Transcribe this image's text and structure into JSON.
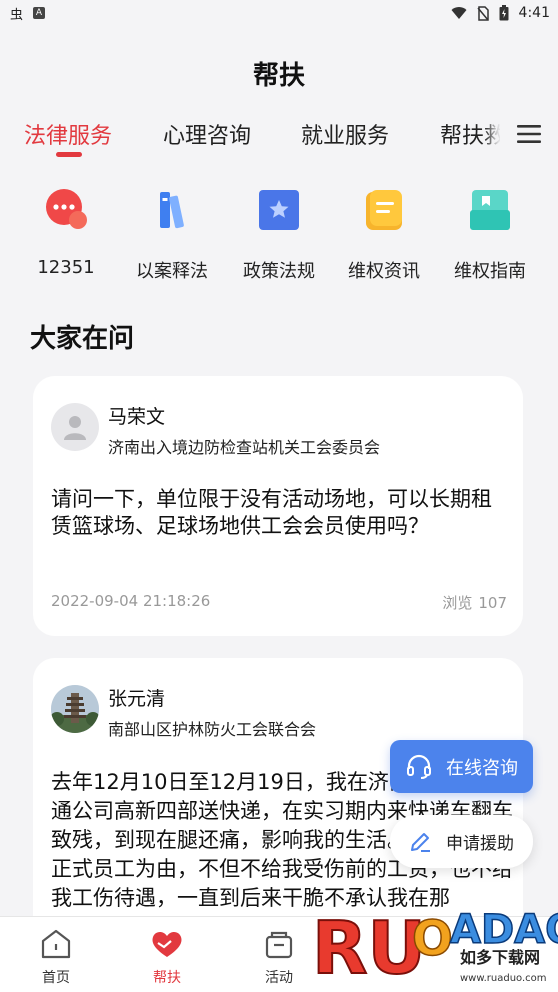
{
  "status_bar": {
    "left_icon_1": "虫",
    "left_icon_2": "A",
    "time": "4:41"
  },
  "header": {
    "title": "帮扶"
  },
  "tabs": [
    {
      "label": "法律服务",
      "active": true
    },
    {
      "label": "心理咨询",
      "active": false
    },
    {
      "label": "就业服务",
      "active": false
    },
    {
      "label": "帮扶救助",
      "active": false
    }
  ],
  "services": [
    {
      "label": "12351",
      "icon": "chat-bubble-icon",
      "color": "#f04848"
    },
    {
      "label": "以案释法",
      "icon": "books-icon",
      "color": "#3f7ff0"
    },
    {
      "label": "政策法规",
      "icon": "star-doc-icon",
      "color": "#4a76e8"
    },
    {
      "label": "维权资讯",
      "icon": "note-icon",
      "color": "#f7b42c"
    },
    {
      "label": "维权指南",
      "icon": "guide-box-icon",
      "color": "#2fc4b4"
    }
  ],
  "section": {
    "title": "大家在问"
  },
  "questions": [
    {
      "name": "马荣文",
      "org": "济南出入境边防检查站机关工会委员会",
      "text": "请问一下，单位限于没有活动场地，可以长期租赁篮球场、足球场地供工会会员使用吗？",
      "date": "2022-09-04 21:18:26",
      "views_label": "浏览",
      "views": "107"
    },
    {
      "name": "张元清",
      "org": "南部山区护林防火工会联合会",
      "text": "去年12月10日至12月19日，我在济南市历城区中通公司高新四部送快递，在实习期内来快递车翻车致残，到现在腿还痛，影响我的生活。老板以不是正式员工为由，不但不给我受伤前的工资，也不给我工伤待遇，一直到后来干脆不承认我在那"
    }
  ],
  "fab": {
    "consult": "在线咨询",
    "apply": "申请援助"
  },
  "bottom_nav": [
    {
      "label": "首页",
      "active": false
    },
    {
      "label": "帮扶",
      "active": true
    },
    {
      "label": "活动",
      "active": false
    }
  ],
  "watermark": {
    "brand": "RUANDADUO",
    "cn": "如多下载网",
    "url": "www.ruaduo.com"
  },
  "colors": {
    "accent": "#e2393f",
    "consult_bg": "#4c83ec",
    "page_bg": "#f4f4f6"
  }
}
